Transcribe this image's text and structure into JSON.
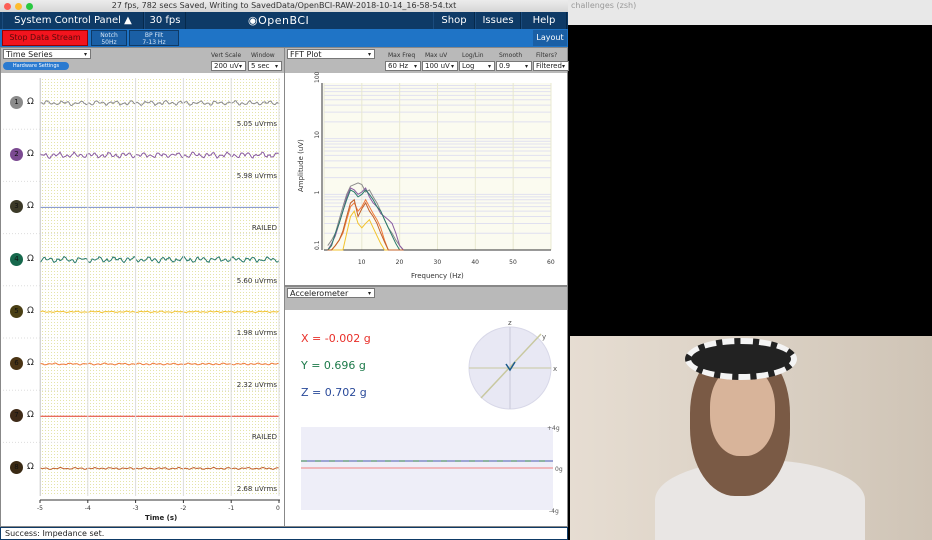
{
  "window_title": "27 fps, 782 secs Saved, Writing to SavedData/OpenBCI-RAW-2018-10-14_16-58-54.txt",
  "terminal_title": "challenges (zsh)",
  "nav": {
    "system_control_panel": "System Control Panel",
    "fps": "30 fps",
    "logo": "OpenBCI",
    "shop": "Shop",
    "issues": "Issues",
    "help": "Help"
  },
  "toolbar": {
    "stop_stream": "Stop Data Stream",
    "notch_line1": "Notch",
    "notch_line2": "50Hz",
    "bp_line1": "BP Filt",
    "bp_line2": "7-13 Hz",
    "layout": "Layout"
  },
  "time_series": {
    "widget": "Time Series",
    "hardware_settings": "Hardware Settings",
    "vert_scale_label": "Vert Scale",
    "vert_scale": "200 uV",
    "window_label": "Window",
    "window": "5 sec",
    "xlabel": "Time (s)",
    "xticks": [
      "-5",
      "-4",
      "-3",
      "-2",
      "-1",
      "0"
    ],
    "channels": [
      {
        "num": "1",
        "rms": "5.05 uVrms",
        "color": "#8b8b8b",
        "trace": "#8b8b8b",
        "amp": 2
      },
      {
        "num": "2",
        "rms": "5.98 uVrms",
        "color": "#7b4a91",
        "trace": "#8a5ca0",
        "amp": 2.5
      },
      {
        "num": "3",
        "rms": "RAILED",
        "color": "#3c3a28",
        "trace": "#7b8fc8",
        "amp": 0
      },
      {
        "num": "4",
        "rms": "5.60 uVrms",
        "color": "#16684c",
        "trace": "#2a7a6a",
        "amp": 2.5
      },
      {
        "num": "5",
        "rms": "1.98 uVrms",
        "color": "#4a3f14",
        "trace": "#f2c22c",
        "amp": 0.6
      },
      {
        "num": "6",
        "rms": "2.32 uVrms",
        "color": "#4a3414",
        "trace": "#f07a3a",
        "amp": 0.8
      },
      {
        "num": "7",
        "rms": "RAILED",
        "color": "#3e2a18",
        "trace": "#e23a2a",
        "amp": 0
      },
      {
        "num": "8",
        "rms": "2.68 uVrms",
        "color": "#3a2a14",
        "trace": "#c0602a",
        "amp": 0.8
      }
    ]
  },
  "fft": {
    "widget": "FFT Plot",
    "controls": [
      {
        "label": "Max Freq",
        "value": "60 Hz"
      },
      {
        "label": "Max uV",
        "value": "100 uV"
      },
      {
        "label": "Log/Lin",
        "value": "Log"
      },
      {
        "label": "Smooth",
        "value": "0.9"
      },
      {
        "label": "Filters?",
        "value": "Filtered"
      }
    ]
  },
  "chart_data": {
    "type": "line",
    "xlabel": "Frequency (Hz)",
    "ylabel": "Amplitude (uV)",
    "xlim": [
      0,
      60
    ],
    "ylim": [
      0.1,
      100
    ],
    "yscale": "log",
    "grid": true,
    "xticks": [
      "10",
      "20",
      "30",
      "40",
      "50",
      "60"
    ],
    "yticks": [
      "0.1",
      "1",
      "10",
      "100"
    ],
    "x": [
      1,
      2,
      3,
      4,
      5,
      6,
      7,
      8,
      9,
      10,
      11,
      12,
      13,
      14,
      15,
      16,
      17,
      18,
      19,
      20,
      21
    ],
    "series": [
      {
        "color": "#8b8b8b",
        "values": [
          0.12,
          0.15,
          0.2,
          0.35,
          0.6,
          1.0,
          1.4,
          1.5,
          1.6,
          1.5,
          1.1,
          1.2,
          0.9,
          0.7,
          0.5,
          0.35,
          0.25,
          0.2,
          0.15,
          0.12,
          0.1
        ]
      },
      {
        "color": "#8a5ca0",
        "values": [
          0.1,
          0.13,
          0.18,
          0.3,
          0.5,
          0.9,
          1.3,
          1.2,
          1.0,
          1.1,
          1.3,
          0.9,
          0.7,
          0.6,
          0.45,
          0.4,
          0.35,
          0.3,
          0.2,
          0.12,
          0.1
        ]
      },
      {
        "color": "#2a7a6a",
        "values": [
          0.1,
          0.12,
          0.2,
          0.3,
          0.5,
          0.8,
          1.2,
          1.1,
          0.9,
          1.0,
          1.2,
          1.0,
          0.8,
          0.6,
          0.5,
          0.35,
          0.25,
          0.18,
          0.13,
          0.1,
          0.1
        ]
      },
      {
        "color": "#f2c22c",
        "values": [
          0.1,
          0.1,
          0.1,
          0.1,
          0.1,
          0.2,
          0.4,
          0.5,
          0.3,
          0.25,
          0.3,
          0.35,
          0.25,
          0.18,
          0.13,
          0.1,
          0.1,
          0.1,
          0.1,
          0.1,
          0.1
        ]
      },
      {
        "color": "#f07a3a",
        "values": [
          0.1,
          0.1,
          0.12,
          0.15,
          0.2,
          0.35,
          0.6,
          0.7,
          0.5,
          0.6,
          0.8,
          0.6,
          0.45,
          0.35,
          0.25,
          0.15,
          0.1,
          0.1,
          0.1,
          0.1,
          0.1
        ]
      },
      {
        "color": "#c0602a",
        "values": [
          0.1,
          0.1,
          0.12,
          0.15,
          0.22,
          0.4,
          0.7,
          0.8,
          0.4,
          0.55,
          0.7,
          0.5,
          0.4,
          0.3,
          0.2,
          0.14,
          0.1,
          0.1,
          0.1,
          0.1,
          0.1
        ]
      }
    ]
  },
  "accel": {
    "widget": "Accelerometer",
    "x": "X = -0.002 g",
    "y": "Y = 0.696 g",
    "z": "Z = 0.702 g",
    "x_color": "#e8302a",
    "y_color": "#1d7a4a",
    "z_color": "#2a4a9a",
    "axis_x": "x",
    "axis_y": "y",
    "axis_z": "z",
    "plus": "+4g",
    "zero": "0g",
    "minus": "-4g"
  },
  "status": "Success: Impedance set."
}
